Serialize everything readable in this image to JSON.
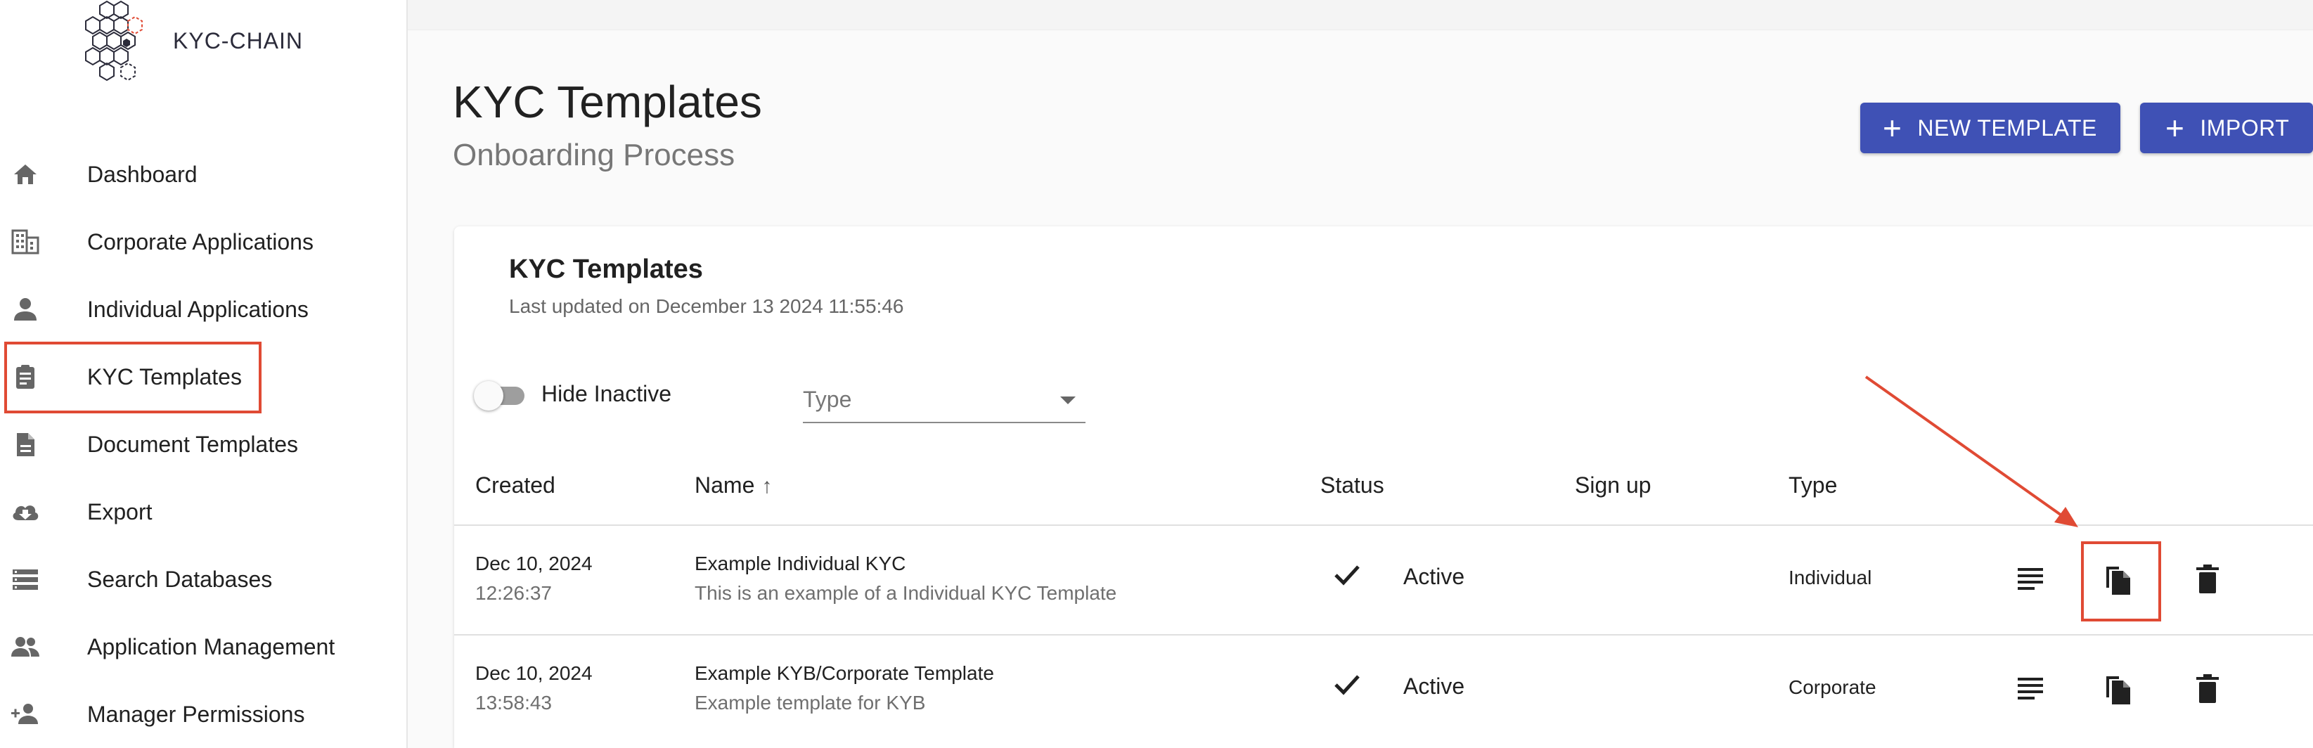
{
  "app": {
    "logo_text": "KYC-CHAIN"
  },
  "sidebar": {
    "items": [
      {
        "label": "Dashboard",
        "icon": "home-icon"
      },
      {
        "label": "Corporate Applications",
        "icon": "building-icon"
      },
      {
        "label": "Individual Applications",
        "icon": "person-icon"
      },
      {
        "label": "KYC Templates",
        "icon": "clipboard-icon",
        "selected": true
      },
      {
        "label": "Document Templates",
        "icon": "document-icon"
      },
      {
        "label": "Export",
        "icon": "cloud-download-icon"
      },
      {
        "label": "Search Databases",
        "icon": "list-icon"
      },
      {
        "label": "Application Management",
        "icon": "people-icon"
      },
      {
        "label": "Manager Permissions",
        "icon": "person-add-icon"
      }
    ]
  },
  "header": {
    "title": "KYC Templates",
    "subtitle": "Onboarding Process",
    "new_template_label": "NEW TEMPLATE",
    "import_label": "IMPORT"
  },
  "card": {
    "title": "KYC Templates",
    "last_updated": "Last updated on December 13 2024 11:55:46"
  },
  "filters": {
    "hide_inactive_label": "Hide Inactive",
    "hide_inactive_on": false,
    "type_placeholder": "Type"
  },
  "table": {
    "columns": {
      "created": "Created",
      "name": "Name",
      "status": "Status",
      "signup": "Sign up",
      "type": "Type"
    },
    "sort": {
      "column": "name",
      "direction": "asc"
    },
    "rows": [
      {
        "date": "Dec 10, 2024",
        "time": "12:26:37",
        "name": "Example Individual KYC",
        "description": "This is an example of a Individual KYC Template",
        "status": "Active",
        "signup": "",
        "type": "Individual"
      },
      {
        "date": "Dec 10, 2024",
        "time": "13:58:43",
        "name": "Example KYB/Corporate Template",
        "description": "Example template for KYB",
        "status": "Active",
        "signup": "",
        "type": "Corporate"
      }
    ]
  },
  "colors": {
    "accent": "#3f51b5",
    "annotation": "#e04a34"
  }
}
